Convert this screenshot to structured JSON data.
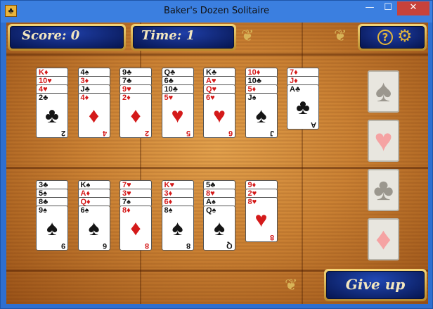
{
  "window": {
    "title": "Baker's Dozen Solitaire",
    "icon": "clubs-card-icon",
    "controls": {
      "minimize": "—",
      "maximize": "☐",
      "close": "✕"
    }
  },
  "hud": {
    "score_label": "Score: 0",
    "time_label": "Time: 1",
    "help_symbol": "?",
    "settings_icon": "gear-icon"
  },
  "tableau_top": [
    {
      "cards": [
        [
          "K",
          "♦",
          "red"
        ],
        [
          "10",
          "♥",
          "red"
        ],
        [
          "4",
          "♥",
          "red"
        ],
        [
          "2",
          "♣",
          "black"
        ]
      ]
    },
    {
      "cards": [
        [
          "4",
          "♠",
          "black"
        ],
        [
          "3",
          "♦",
          "red"
        ],
        [
          "J",
          "♣",
          "black"
        ],
        [
          "4",
          "♦",
          "red"
        ]
      ]
    },
    {
      "cards": [
        [
          "9",
          "♣",
          "black"
        ],
        [
          "7",
          "♣",
          "black"
        ],
        [
          "9",
          "♥",
          "red"
        ],
        [
          "2",
          "♦",
          "red"
        ]
      ]
    },
    {
      "cards": [
        [
          "Q",
          "♣",
          "black"
        ],
        [
          "6",
          "♣",
          "black"
        ],
        [
          "10",
          "♣",
          "black"
        ],
        [
          "5",
          "♥",
          "red"
        ]
      ]
    },
    {
      "cards": [
        [
          "K",
          "♣",
          "black"
        ],
        [
          "A",
          "♥",
          "red"
        ],
        [
          "Q",
          "♥",
          "red"
        ],
        [
          "6",
          "♥",
          "red"
        ]
      ]
    },
    {
      "cards": [
        [
          "10",
          "♦",
          "red"
        ],
        [
          "10",
          "♣",
          "black"
        ],
        [
          "5",
          "♦",
          "red"
        ],
        [
          "J",
          "♠",
          "black"
        ]
      ]
    },
    {
      "cards": [
        [
          "7",
          "♦",
          "red"
        ],
        [
          "J",
          "♦",
          "red"
        ],
        [
          "A",
          "♣",
          "black"
        ]
      ]
    }
  ],
  "tableau_bottom": [
    {
      "cards": [
        [
          "3",
          "♣",
          "black"
        ],
        [
          "5",
          "♠",
          "black"
        ],
        [
          "8",
          "♣",
          "black"
        ],
        [
          "9",
          "♠",
          "black"
        ]
      ]
    },
    {
      "cards": [
        [
          "K",
          "♠",
          "black"
        ],
        [
          "A",
          "♦",
          "red"
        ],
        [
          "Q",
          "♦",
          "red"
        ],
        [
          "6",
          "♠",
          "black"
        ]
      ]
    },
    {
      "cards": [
        [
          "7",
          "♥",
          "red"
        ],
        [
          "3",
          "♥",
          "red"
        ],
        [
          "7",
          "♠",
          "black"
        ],
        [
          "8",
          "♦",
          "red"
        ]
      ]
    },
    {
      "cards": [
        [
          "K",
          "♥",
          "red"
        ],
        [
          "3",
          "♦",
          "red"
        ],
        [
          "6",
          "♦",
          "red"
        ],
        [
          "8",
          "♠",
          "black"
        ]
      ]
    },
    {
      "cards": [
        [
          "5",
          "♣",
          "black"
        ],
        [
          "8",
          "♥",
          "red"
        ],
        [
          "A",
          "♠",
          "black"
        ],
        [
          "Q",
          "♠",
          "black"
        ]
      ]
    },
    {
      "cards": [
        [
          "9",
          "♦",
          "red"
        ],
        [
          "2",
          "♥",
          "red"
        ],
        [
          "8",
          "♥",
          "red"
        ]
      ]
    }
  ],
  "foundations": [
    {
      "suit": "♠",
      "color": "black"
    },
    {
      "suit": "♥",
      "color": "red"
    },
    {
      "suit": "♣",
      "color": "black"
    },
    {
      "suit": "♦",
      "color": "red"
    }
  ],
  "give_up_label": "Give up",
  "colors": {
    "hud_blue": "#06154f",
    "gold": "#e3b63b",
    "card_red": "#d41a1a"
  }
}
